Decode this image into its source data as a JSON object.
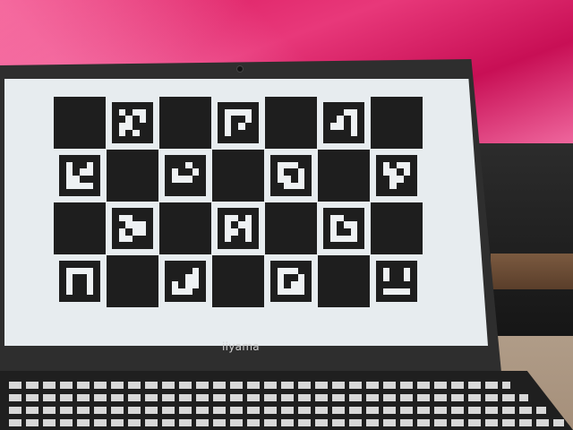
{
  "brand": "iiyama",
  "board": {
    "rows": 4,
    "cols": 7,
    "dark": [
      [
        1,
        0,
        1,
        0,
        1,
        0,
        1
      ],
      [
        0,
        1,
        0,
        1,
        0,
        1,
        0
      ],
      [
        1,
        0,
        1,
        0,
        1,
        0,
        1
      ],
      [
        0,
        1,
        0,
        1,
        0,
        1,
        0
      ]
    ],
    "markers": [
      {
        "r": 0,
        "c": 1,
        "bits": [
          [
            0,
            0,
            0,
            0,
            0,
            0
          ],
          [
            0,
            1,
            0,
            1,
            1,
            0
          ],
          [
            0,
            0,
            1,
            0,
            1,
            0
          ],
          [
            0,
            1,
            1,
            0,
            0,
            0
          ],
          [
            0,
            1,
            0,
            1,
            0,
            0
          ],
          [
            0,
            0,
            0,
            0,
            0,
            0
          ]
        ]
      },
      {
        "r": 0,
        "c": 3,
        "bits": [
          [
            0,
            0,
            0,
            0,
            0,
            0
          ],
          [
            0,
            1,
            1,
            1,
            1,
            0
          ],
          [
            0,
            1,
            0,
            0,
            1,
            0
          ],
          [
            0,
            1,
            0,
            1,
            0,
            0
          ],
          [
            0,
            1,
            0,
            0,
            0,
            0
          ],
          [
            0,
            0,
            0,
            0,
            0,
            0
          ]
        ]
      },
      {
        "r": 0,
        "c": 5,
        "bits": [
          [
            0,
            0,
            0,
            0,
            0,
            0
          ],
          [
            0,
            0,
            0,
            1,
            1,
            0
          ],
          [
            0,
            0,
            1,
            0,
            1,
            0
          ],
          [
            0,
            1,
            1,
            0,
            1,
            0
          ],
          [
            0,
            0,
            0,
            0,
            1,
            0
          ],
          [
            0,
            0,
            0,
            0,
            0,
            0
          ]
        ]
      },
      {
        "r": 1,
        "c": 0,
        "bits": [
          [
            0,
            0,
            0,
            0,
            0,
            0
          ],
          [
            0,
            1,
            0,
            0,
            1,
            0
          ],
          [
            0,
            1,
            0,
            1,
            1,
            0
          ],
          [
            0,
            1,
            1,
            0,
            0,
            0
          ],
          [
            0,
            1,
            1,
            1,
            1,
            0
          ],
          [
            0,
            0,
            0,
            0,
            0,
            0
          ]
        ]
      },
      {
        "r": 1,
        "c": 2,
        "bits": [
          [
            0,
            0,
            0,
            0,
            0,
            0
          ],
          [
            0,
            0,
            0,
            1,
            0,
            0
          ],
          [
            0,
            1,
            0,
            0,
            1,
            0
          ],
          [
            0,
            1,
            1,
            1,
            0,
            0
          ],
          [
            0,
            0,
            0,
            0,
            0,
            0
          ],
          [
            0,
            0,
            0,
            0,
            0,
            0
          ]
        ]
      },
      {
        "r": 1,
        "c": 4,
        "bits": [
          [
            0,
            0,
            0,
            0,
            0,
            0
          ],
          [
            0,
            1,
            1,
            1,
            0,
            0
          ],
          [
            0,
            1,
            0,
            0,
            1,
            0
          ],
          [
            0,
            1,
            1,
            0,
            1,
            0
          ],
          [
            0,
            0,
            1,
            1,
            1,
            0
          ],
          [
            0,
            0,
            0,
            0,
            0,
            0
          ]
        ]
      },
      {
        "r": 1,
        "c": 6,
        "bits": [
          [
            0,
            0,
            0,
            0,
            0,
            0
          ],
          [
            0,
            1,
            0,
            1,
            1,
            0
          ],
          [
            0,
            1,
            1,
            0,
            1,
            0
          ],
          [
            0,
            0,
            1,
            1,
            0,
            0
          ],
          [
            0,
            0,
            1,
            0,
            0,
            0
          ],
          [
            0,
            0,
            0,
            0,
            0,
            0
          ]
        ]
      },
      {
        "r": 2,
        "c": 1,
        "bits": [
          [
            0,
            0,
            0,
            0,
            0,
            0
          ],
          [
            0,
            1,
            1,
            0,
            0,
            0
          ],
          [
            0,
            0,
            1,
            1,
            1,
            0
          ],
          [
            0,
            1,
            0,
            1,
            1,
            0
          ],
          [
            0,
            1,
            1,
            0,
            0,
            0
          ],
          [
            0,
            0,
            0,
            0,
            0,
            0
          ]
        ]
      },
      {
        "r": 2,
        "c": 3,
        "bits": [
          [
            0,
            0,
            0,
            0,
            0,
            0
          ],
          [
            0,
            1,
            1,
            0,
            1,
            0
          ],
          [
            0,
            1,
            0,
            1,
            1,
            0
          ],
          [
            0,
            1,
            1,
            0,
            1,
            0
          ],
          [
            0,
            1,
            0,
            0,
            1,
            0
          ],
          [
            0,
            0,
            0,
            0,
            0,
            0
          ]
        ]
      },
      {
        "r": 2,
        "c": 5,
        "bits": [
          [
            0,
            0,
            0,
            0,
            0,
            0
          ],
          [
            0,
            1,
            1,
            0,
            0,
            0
          ],
          [
            0,
            1,
            0,
            1,
            1,
            0
          ],
          [
            0,
            1,
            0,
            0,
            1,
            0
          ],
          [
            0,
            1,
            1,
            1,
            1,
            0
          ],
          [
            0,
            0,
            0,
            0,
            0,
            0
          ]
        ]
      },
      {
        "r": 3,
        "c": 0,
        "bits": [
          [
            0,
            0,
            0,
            0,
            0,
            0
          ],
          [
            0,
            1,
            1,
            1,
            1,
            0
          ],
          [
            0,
            1,
            0,
            0,
            1,
            0
          ],
          [
            0,
            1,
            0,
            0,
            1,
            0
          ],
          [
            0,
            1,
            0,
            0,
            1,
            0
          ],
          [
            0,
            0,
            0,
            0,
            0,
            0
          ]
        ]
      },
      {
        "r": 3,
        "c": 2,
        "bits": [
          [
            0,
            0,
            0,
            0,
            0,
            0
          ],
          [
            0,
            0,
            0,
            0,
            1,
            0
          ],
          [
            0,
            0,
            0,
            1,
            1,
            0
          ],
          [
            0,
            1,
            0,
            1,
            1,
            0
          ],
          [
            0,
            1,
            1,
            1,
            0,
            0
          ],
          [
            0,
            0,
            0,
            0,
            0,
            0
          ]
        ]
      },
      {
        "r": 3,
        "c": 4,
        "bits": [
          [
            0,
            0,
            0,
            0,
            0,
            0
          ],
          [
            0,
            1,
            1,
            1,
            0,
            0
          ],
          [
            0,
            1,
            0,
            0,
            1,
            0
          ],
          [
            0,
            1,
            0,
            1,
            1,
            0
          ],
          [
            0,
            1,
            1,
            1,
            1,
            0
          ],
          [
            0,
            0,
            0,
            0,
            0,
            0
          ]
        ]
      },
      {
        "r": 3,
        "c": 6,
        "bits": [
          [
            0,
            0,
            0,
            0,
            0,
            0
          ],
          [
            0,
            1,
            0,
            0,
            1,
            0
          ],
          [
            0,
            1,
            0,
            0,
            1,
            0
          ],
          [
            0,
            0,
            0,
            0,
            0,
            0
          ],
          [
            0,
            1,
            1,
            1,
            1,
            0
          ],
          [
            0,
            0,
            0,
            0,
            0,
            0
          ]
        ]
      }
    ]
  }
}
